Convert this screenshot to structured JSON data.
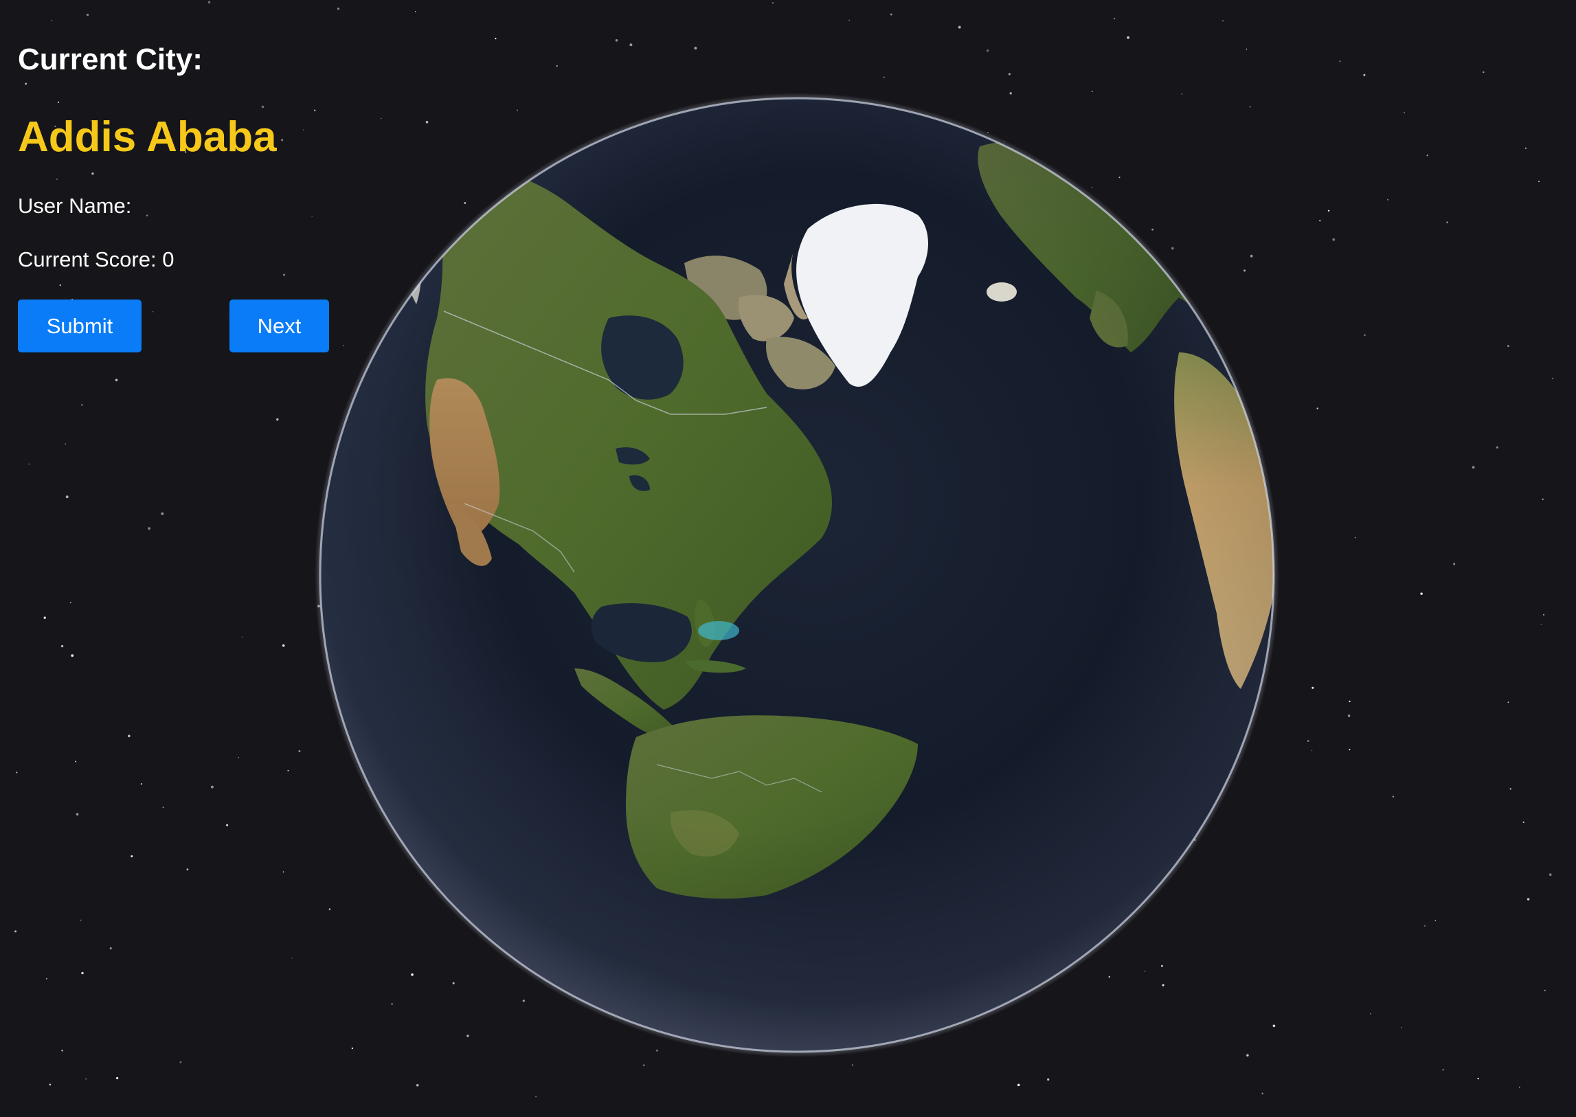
{
  "hud": {
    "current_city_label": "Current City:",
    "current_city_value": "Addis Ababa",
    "user_name_label": "User Name:",
    "user_name_value": "",
    "score_label": "Current Score:",
    "score_value": "0",
    "submit_label": "Submit",
    "next_label": "Next"
  },
  "colors": {
    "background": "#15151a",
    "city_highlight": "#f6c819",
    "button": "#0a7cf7",
    "text": "#ffffff"
  },
  "globe": {
    "view": "3D Earth globe centered on North America",
    "icon": "earth-globe-icon"
  }
}
